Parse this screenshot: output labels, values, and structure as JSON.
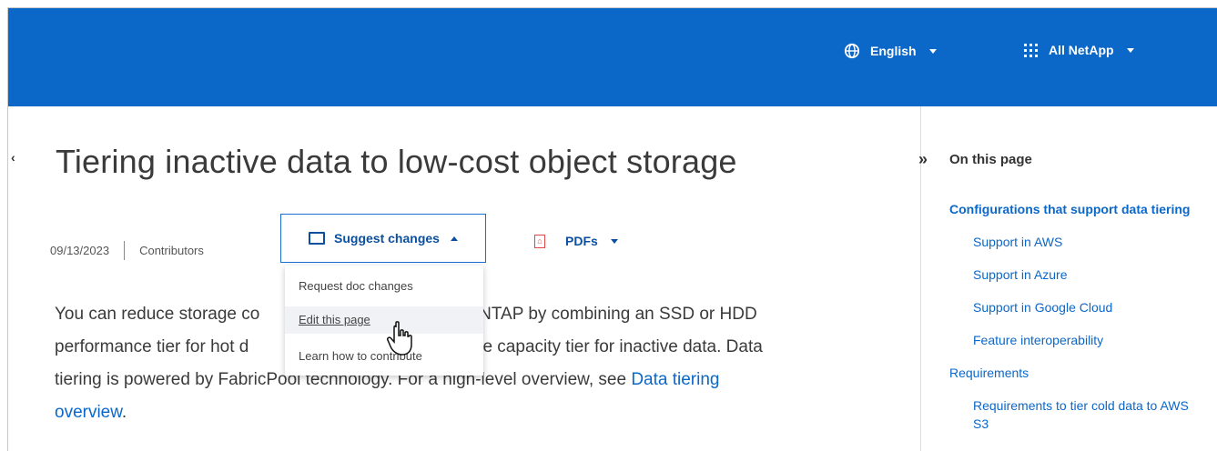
{
  "header": {
    "language_label": "English",
    "all_label": "All NetApp"
  },
  "page": {
    "title": "Tiering inactive data to low-cost object storage",
    "date": "09/13/2023",
    "contributors_label": "Contributors",
    "suggest_changes_label": "Suggest changes",
    "pdfs_label": "PDFs",
    "paragraph_before": "You can reduce storage co",
    "paragraph_mid": "ONTAP by combining an SSD or HDD",
    "paragraph_line2a": "performance tier for hot d",
    "paragraph_line2b": "age capacity tier for inactive data. Data",
    "paragraph_line3": "tiering is powered by FabricPool technology. For a high-level overview, see ",
    "paragraph_link": "Data tiering",
    "paragraph_link2": "overview",
    "paragraph_end": "."
  },
  "dropdown": {
    "items": [
      "Request doc changes",
      "Edit this page",
      "Learn how to contribute"
    ]
  },
  "toc": {
    "heading": "On this page",
    "section": "Configurations that support data tiering",
    "items": [
      "Support in AWS",
      "Support in Azure",
      "Support in Google Cloud",
      "Feature interoperability"
    ],
    "requirements": "Requirements",
    "sub_items": [
      "Requirements to tier cold data to AWS S3"
    ]
  },
  "icons": {
    "back": "chevron-left-icon",
    "toggle": "double-chevron-right-icon"
  }
}
